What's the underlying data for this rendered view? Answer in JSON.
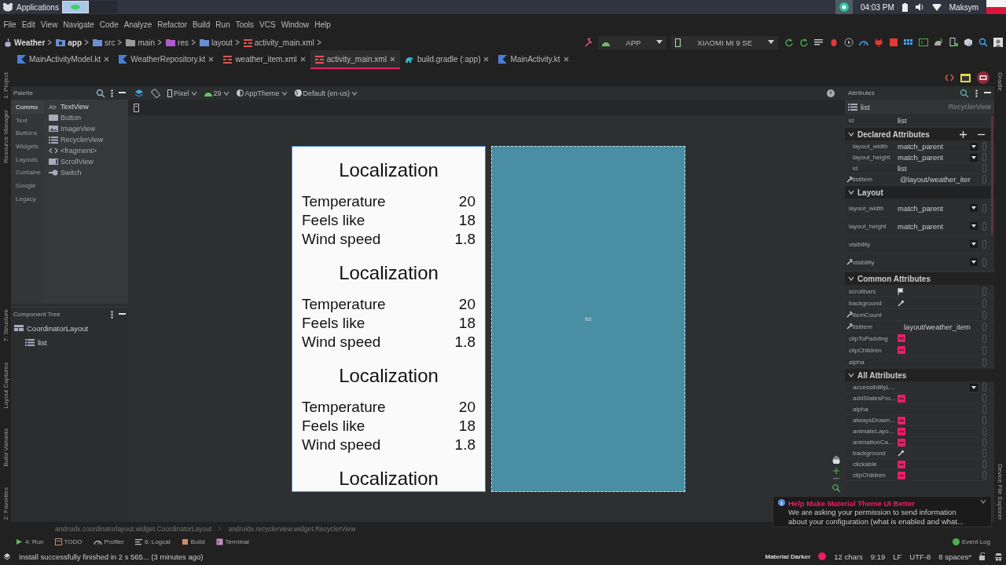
{
  "system_bar": {
    "apps_label": "Applications",
    "clock": "04:03 PM",
    "user": "Maksym"
  },
  "menu": [
    "File",
    "Edit",
    "View",
    "Navigate",
    "Code",
    "Analyze",
    "Refactor",
    "Build",
    "Run",
    "Tools",
    "VCS",
    "Window",
    "Help"
  ],
  "breadcrumb": [
    {
      "label": "Weather",
      "kind": "project"
    },
    {
      "label": "app",
      "kind": "module"
    },
    {
      "label": "src",
      "kind": "folder"
    },
    {
      "label": "main",
      "kind": "plain"
    },
    {
      "label": "res",
      "kind": "res"
    },
    {
      "label": "layout",
      "kind": "folder"
    },
    {
      "label": "activity_main.xml",
      "kind": "xml"
    }
  ],
  "run_config": {
    "module": "APP",
    "device": "XIAOMI MI 9 SE"
  },
  "tabs": [
    {
      "label": "MainActivityModel.kt",
      "kind": "kotlin",
      "selected": false
    },
    {
      "label": "WeatherRepository.kt",
      "kind": "kotlin",
      "selected": false
    },
    {
      "label": "weather_item.xml",
      "kind": "xml",
      "selected": false
    },
    {
      "label": "activity_main.xml",
      "kind": "xml",
      "selected": true
    },
    {
      "label": "build.gradle (:app)",
      "kind": "gradle",
      "selected": false
    },
    {
      "label": "MainActivity.kt",
      "kind": "kotlin",
      "selected": false
    }
  ],
  "left_stripe": {
    "top": [
      "1: Project",
      "Resource Manager"
    ],
    "bottom": [
      "7: Structure",
      "Layout Captures",
      "Build Variants",
      "2: Favorites"
    ]
  },
  "right_stripe": {
    "top": [
      "Gradle"
    ],
    "bottom": [
      "Device File Explorer"
    ]
  },
  "palette": {
    "title": "Palette",
    "categories": [
      {
        "label": "Commo",
        "selected": true
      },
      {
        "label": "Text",
        "selected": false
      },
      {
        "label": "Buttons",
        "selected": false
      },
      {
        "label": "Widgets",
        "selected": false
      },
      {
        "label": "Layouts",
        "selected": false
      },
      {
        "label": "Containe",
        "selected": false
      },
      {
        "label": "Google",
        "selected": false
      },
      {
        "label": "Legacy",
        "selected": false
      }
    ],
    "items": [
      {
        "label": "TextView",
        "kind": "text",
        "icon_text": "Ab"
      },
      {
        "label": "Button",
        "kind": "button"
      },
      {
        "label": "ImageView",
        "kind": "image"
      },
      {
        "label": "RecyclerView",
        "kind": "list"
      },
      {
        "label": "<fragment>",
        "kind": "fragment"
      },
      {
        "label": "ScrollView",
        "kind": "scroll"
      },
      {
        "label": "Switch",
        "kind": "switch"
      }
    ]
  },
  "component_tree": {
    "title": "Component Tree",
    "nodes": [
      {
        "label": "CoordinatorLayout",
        "kind": "layout",
        "children": [
          {
            "label": "list",
            "kind": "list"
          }
        ]
      }
    ]
  },
  "designer_toolbar": {
    "device": "Pixel",
    "api": "29",
    "theme": "AppTheme",
    "locale": "Default (en-us)"
  },
  "preview": {
    "items": [
      {
        "title": "Localization",
        "rows": [
          {
            "label": "Temperature",
            "value": "20"
          },
          {
            "label": "Feels like",
            "value": "18"
          },
          {
            "label": "Wind speed",
            "value": "1.8"
          }
        ]
      },
      {
        "title": "Localization",
        "rows": [
          {
            "label": "Temperature",
            "value": "20"
          },
          {
            "label": "Feels like",
            "value": "18"
          },
          {
            "label": "Wind speed",
            "value": "1.8"
          }
        ]
      },
      {
        "title": "Localization",
        "rows": [
          {
            "label": "Temperature",
            "value": "20"
          },
          {
            "label": "Feels like",
            "value": "18"
          },
          {
            "label": "Wind speed",
            "value": "1.8"
          }
        ]
      },
      {
        "title": "Localization"
      }
    ]
  },
  "blueprint": {
    "label": "list"
  },
  "attributes": {
    "title": "Attributes",
    "component": {
      "name": "list",
      "type": "RecyclerView"
    },
    "id_row": {
      "name": "id",
      "value": "list"
    },
    "sections": [
      {
        "title": "Declared Attributes",
        "kind": "declared",
        "expanded": true,
        "rows": [
          {
            "name": "layout_width",
            "value": "match_parent",
            "kind": "dropdown",
            "wrench": false
          },
          {
            "name": "layout_height",
            "value": "match_parent",
            "kind": "dropdown",
            "wrench": false
          },
          {
            "name": "id",
            "value": "list",
            "kind": "text",
            "wrench": false
          },
          {
            "name": "listitem",
            "value": "@layout/weather_iter",
            "kind": "text",
            "wrench": true
          }
        ]
      },
      {
        "title": "Layout",
        "kind": "layout",
        "expanded": true,
        "rows": [
          {
            "name": "layout_width",
            "value": "match_parent",
            "kind": "dropdown",
            "wrench": false
          },
          {
            "name": "layout_height",
            "value": "match_parent",
            "kind": "dropdown",
            "wrench": false
          },
          {
            "name": "visibility",
            "kind": "dropdown",
            "wrench": false
          },
          {
            "name": "visibility",
            "kind": "dropdown",
            "wrench": true
          }
        ]
      },
      {
        "title": "Common Attributes",
        "kind": "common",
        "expanded": true,
        "rows": [
          {
            "name": "scrollbars",
            "kind": "flag",
            "wrench": false
          },
          {
            "name": "background",
            "kind": "picker",
            "wrench": false
          },
          {
            "name": "itemCount",
            "kind": "text",
            "wrench": true
          },
          {
            "name": "listitem",
            "value": "layout/weather_item",
            "kind": "text",
            "wrench": true
          },
          {
            "name": "clipToPadding",
            "kind": "toggle",
            "wrench": false,
            "checked": false
          },
          {
            "name": "clipChildren",
            "kind": "toggle",
            "wrench": false,
            "checked": false
          },
          {
            "name": "alpha",
            "kind": "text",
            "wrench": false
          }
        ]
      },
      {
        "title": "All Attributes",
        "kind": "all",
        "expanded": true,
        "rows": [
          {
            "name": "accessibilityL...",
            "kind": "dropdown",
            "wrench": false
          },
          {
            "name": "addStatesFro...",
            "kind": "toggle",
            "wrench": false,
            "checked": false
          },
          {
            "name": "alpha",
            "kind": "text",
            "wrench": false
          },
          {
            "name": "alwaysDrawn...",
            "kind": "toggle",
            "wrench": false,
            "checked": false
          },
          {
            "name": "animateLayo...",
            "kind": "toggle",
            "wrench": false,
            "checked": false
          },
          {
            "name": "animationCa...",
            "kind": "toggle",
            "wrench": false,
            "checked": false
          },
          {
            "name": "background",
            "kind": "picker",
            "wrench": false
          },
          {
            "name": "clickable",
            "kind": "toggle",
            "wrench": false,
            "checked": false
          },
          {
            "name": "clipChildren",
            "kind": "toggle",
            "wrench": false,
            "checked": false
          }
        ]
      }
    ]
  },
  "notification": {
    "title": "Help Make Material Theme UI Better",
    "body": "We are asking your permission to send information about your configuration (what is enabled and what..."
  },
  "bottom_breadcrumb": [
    "androidx.coordinatorlayout.widget.CoordinatorLayout",
    "androidx.recyclerview.widget.RecyclerView"
  ],
  "tool_buttons": [
    {
      "label": "4: Run",
      "kind": "run"
    },
    {
      "label": "TODO",
      "kind": "todo"
    },
    {
      "label": "Profiler",
      "kind": "profiler"
    },
    {
      "label": "6: Logcat",
      "kind": "logcat"
    },
    {
      "label": "Build",
      "kind": "build"
    },
    {
      "label": "Terminal",
      "kind": "terminal"
    }
  ],
  "event_log": "Event Log",
  "status": {
    "message": "Install successfully finished in 2 s 565... (3 minutes ago)",
    "theme": "Material Darker",
    "chars": "12 chars",
    "position": "9:19",
    "line_separator": "LF",
    "encoding": "UTF-8",
    "indent": "8 spaces*"
  }
}
